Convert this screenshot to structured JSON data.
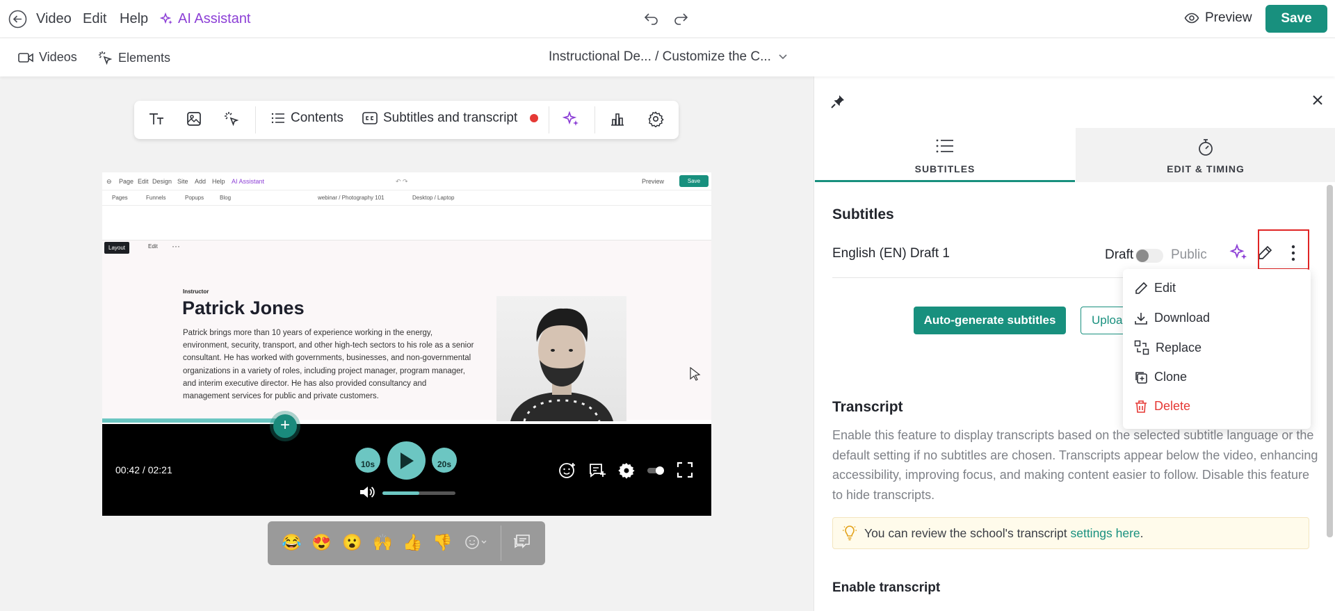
{
  "topbar": {
    "menus": [
      "Video",
      "Edit",
      "Help"
    ],
    "ai_assistant": "AI Assistant",
    "preview": "Preview",
    "save": "Save",
    "accent": "#18907e",
    "ai_color": "#8c3fd6"
  },
  "subbar": {
    "videos": "Videos",
    "elements": "Elements",
    "breadcrumb": "Instructional De...  / Customize the C..."
  },
  "toolbar": {
    "contents": "Contents",
    "subtitles_transcript": "Subtitles and transcript",
    "icons": [
      "text-size-icon",
      "image-icon",
      "click-icon",
      "list-icon",
      "cc-icon",
      "sparkle-icon",
      "chart-icon",
      "gear-icon"
    ]
  },
  "video": {
    "mini_nav": [
      "Page",
      "Edit",
      "Design",
      "Site",
      "Add",
      "Help",
      "AI Assistant"
    ],
    "mini_preview": "Preview",
    "mini_save": "Save",
    "mini_tabs": [
      "Pages",
      "Funnels",
      "Popups",
      "Blog"
    ],
    "mini_breadcrumb": "webinar / Photography 101",
    "mini_device": "Desktop / Laptop",
    "layout_chip": "Layout",
    "edit_chip": "Edit",
    "instructor_label": "Instructor",
    "instructor_name": "Patrick Jones",
    "bio": "Patrick brings more than 10 years of experience working in the energy, environment, security, transport, and other high-tech sectors to his role as a senior consultant. He has worked with governments, businesses, and non-governmental organizations in a variety of roles, including project manager, program manager, and interim executive director. He has also provided consultancy and management services for public and private customers.",
    "timecode": "00:42 / 02:21",
    "rewind": "10s",
    "forward": "20s",
    "progress_fraction": 0.3,
    "volume_fraction": 0.5
  },
  "reactions": {
    "emojis": [
      "😂",
      "😍",
      "😮",
      "🙌",
      "👍",
      "👎"
    ]
  },
  "panel": {
    "tabs": [
      "SUBTITLES",
      "EDIT & TIMING"
    ],
    "subtitles_heading": "Subtitles",
    "subtitle_language": "English (EN) Draft 1",
    "draft": "Draft",
    "public": "Public",
    "autogen": "Auto-generate subtitles",
    "upload": "Upload",
    "menu": [
      "Edit",
      "Download",
      "Replace",
      "Clone",
      "Delete"
    ],
    "transcript_heading": "Transcript",
    "transcript_desc": "Enable this feature to display transcripts based on the selected subtitle language or the default setting if no subtitles are chosen. Transcripts appear below the video, enhancing accessibility, improving focus, and making content easier to follow. Disable this feature to hide transcripts.",
    "tip_text": "You can review the school's transcript ",
    "tip_link": "settings here",
    "tip_end": ".",
    "enable_heading": "Enable transcript"
  }
}
